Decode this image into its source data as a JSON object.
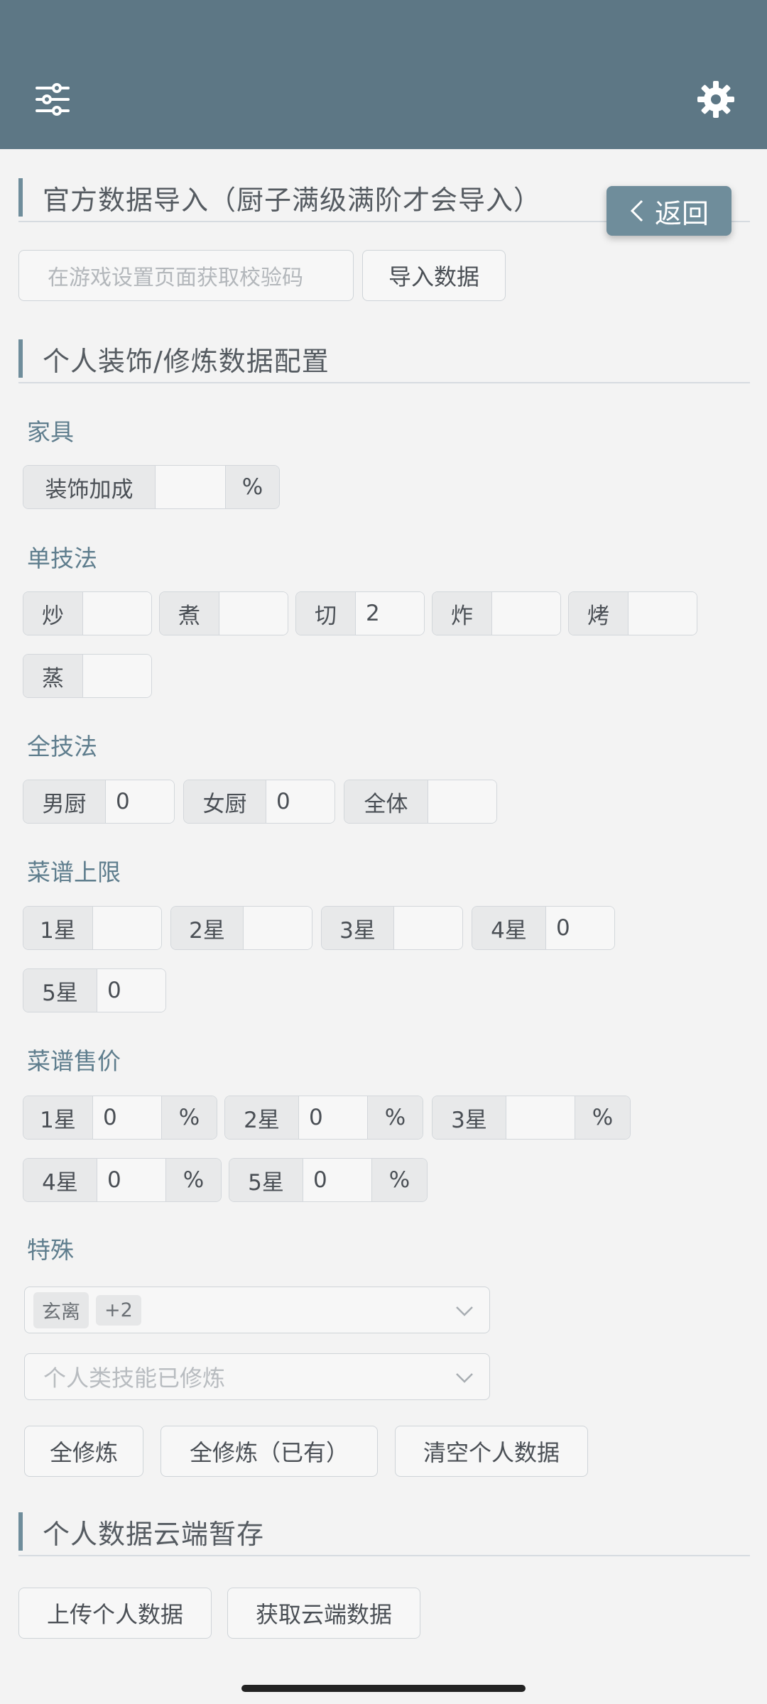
{
  "header": {
    "menu_icon": "sliders-icon",
    "settings_icon": "gear-icon"
  },
  "back_button": {
    "label": "返回"
  },
  "official_import": {
    "title": "官方数据导入（厨子满级满阶才会导入）",
    "code_placeholder": "在游戏设置页面获取校验码",
    "import_label": "导入数据"
  },
  "personal": {
    "title": "个人装饰/修炼数据配置",
    "furniture": {
      "heading": "家具",
      "label": "装饰加成",
      "value": "",
      "unit": "%"
    },
    "single_skill": {
      "heading": "单技法",
      "items": [
        {
          "label": "炒",
          "value": ""
        },
        {
          "label": "煮",
          "value": ""
        },
        {
          "label": "切",
          "value": "2"
        },
        {
          "label": "炸",
          "value": ""
        },
        {
          "label": "烤",
          "value": ""
        },
        {
          "label": "蒸",
          "value": ""
        }
      ]
    },
    "all_skill": {
      "heading": "全技法",
      "items": [
        {
          "label": "男厨",
          "value": "0"
        },
        {
          "label": "女厨",
          "value": "0"
        },
        {
          "label": "全体",
          "value": ""
        }
      ]
    },
    "recipe_limit": {
      "heading": "菜谱上限",
      "items": [
        {
          "label": "1星",
          "value": ""
        },
        {
          "label": "2星",
          "value": ""
        },
        {
          "label": "3星",
          "value": ""
        },
        {
          "label": "4星",
          "value": "0"
        },
        {
          "label": "5星",
          "value": "0"
        }
      ]
    },
    "recipe_price": {
      "heading": "菜谱售价",
      "unit": "%",
      "items": [
        {
          "label": "1星",
          "value": "0"
        },
        {
          "label": "2星",
          "value": "0"
        },
        {
          "label": "3星",
          "value": ""
        },
        {
          "label": "4星",
          "value": "0"
        },
        {
          "label": "5星",
          "value": "0"
        }
      ]
    },
    "special": {
      "heading": "特殊",
      "tags": [
        "玄离",
        "+2"
      ],
      "skill_placeholder": "个人类技能已修炼"
    },
    "actions": {
      "all_train": "全修炼",
      "all_train_owned": "全修炼（已有）",
      "clear": "清空个人数据"
    }
  },
  "cloud": {
    "title": "个人数据云端暂存",
    "upload": "上传个人数据",
    "fetch": "获取云端数据"
  }
}
